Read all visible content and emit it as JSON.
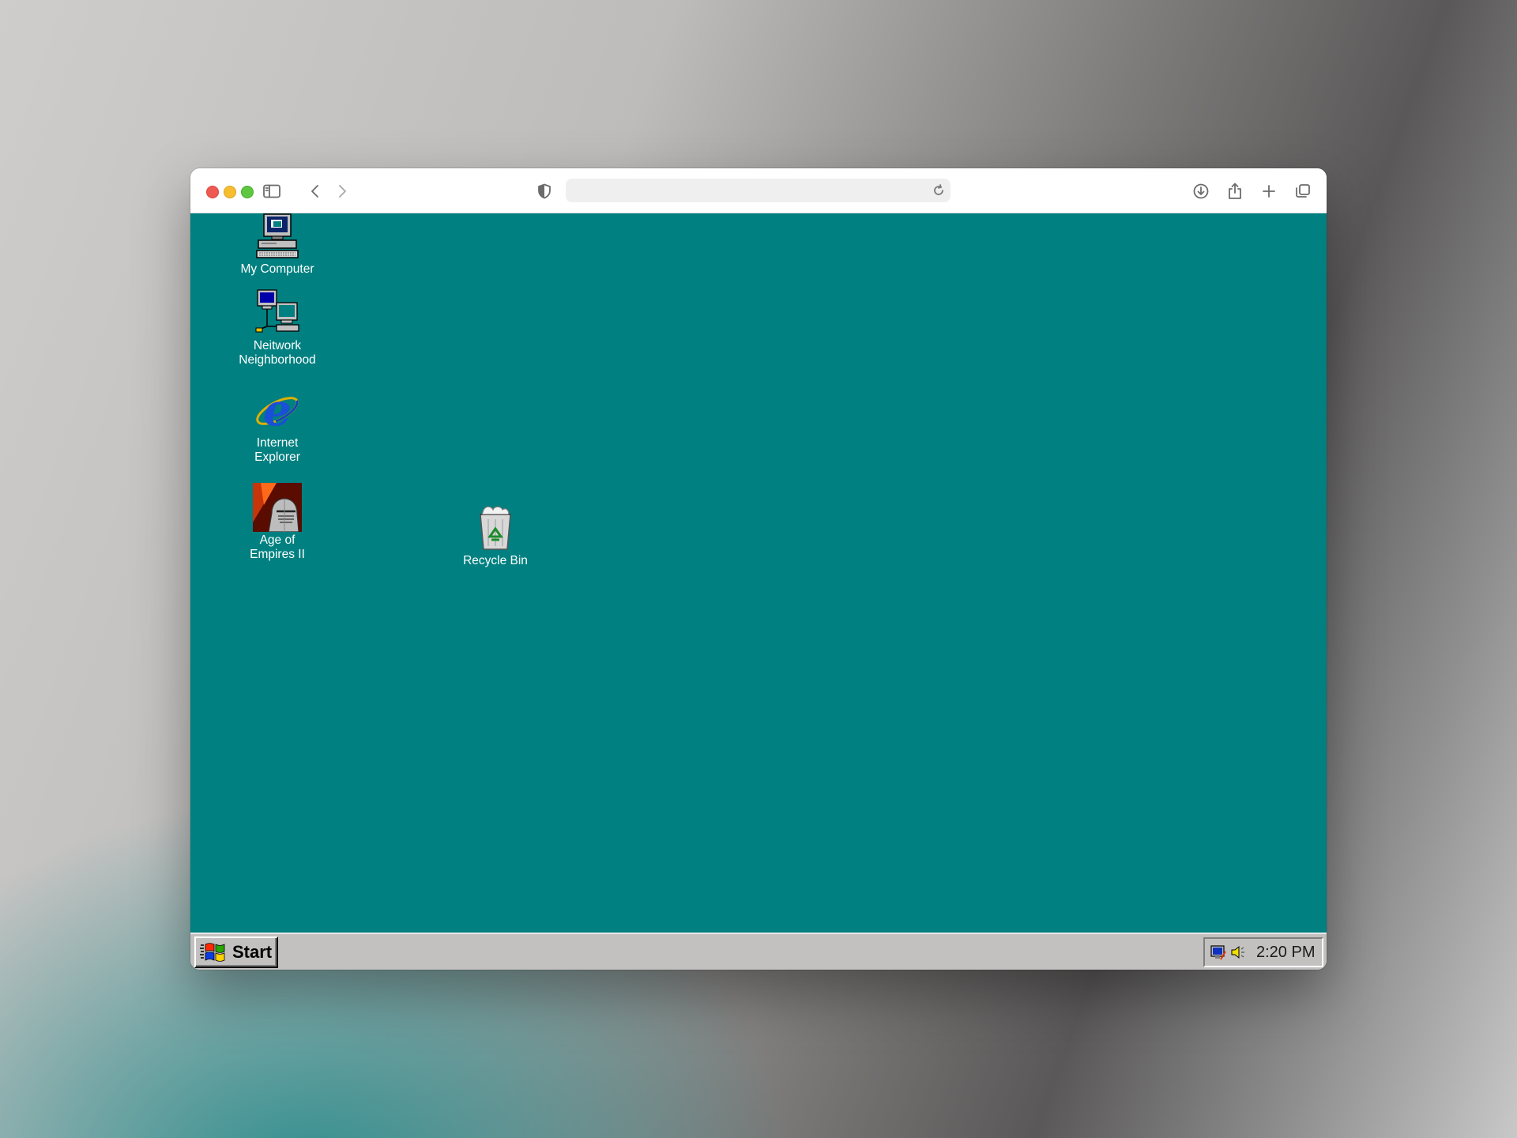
{
  "browser": {
    "address_value": "",
    "address_placeholder": ""
  },
  "desktop": {
    "background_color": "#008080",
    "icons": [
      {
        "label": "My Computer",
        "icon": "my-computer-icon"
      },
      {
        "label": "Neitwork\nNeighborhood",
        "icon": "network-neighborhood-icon"
      },
      {
        "label": "Internet\nExplorer",
        "icon": "internet-explorer-icon"
      },
      {
        "label": "Age of\nEmpires II",
        "icon": "age-of-empires-icon"
      },
      {
        "label": "Recycle Bin",
        "icon": "recycle-bin-icon"
      }
    ]
  },
  "taskbar": {
    "start_label": "Start",
    "clock": "2:20 PM",
    "tray_icons": [
      "display-settings-icon",
      "volume-icon"
    ]
  }
}
